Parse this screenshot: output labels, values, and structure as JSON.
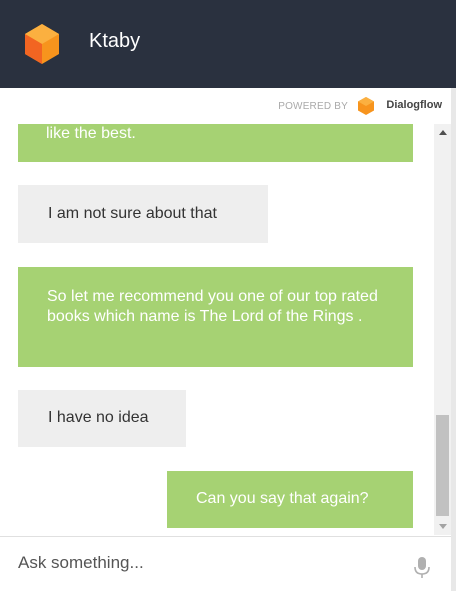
{
  "header": {
    "title": "Ktaby"
  },
  "powered": {
    "label": "POWERED BY",
    "brand": "Dialogflow"
  },
  "messages": [
    {
      "role": "bot",
      "text": "like the best."
    },
    {
      "role": "user",
      "text": "I am not sure about that"
    },
    {
      "role": "bot",
      "text": "So let me recommend you one of our top rated books which name is The Lord of the Rings ."
    },
    {
      "role": "user",
      "text": "I have no idea"
    },
    {
      "role": "bot",
      "text": "Can you say that again?"
    }
  ],
  "input": {
    "placeholder": "Ask something..."
  },
  "icons": {
    "logo": "cube-logo-icon",
    "dialogflow": "dialogflow-logo-icon",
    "mic": "microphone-icon"
  },
  "colors": {
    "header_bg": "#2a313f",
    "bot_bubble": "#a6d273",
    "user_bubble": "#eeeeee",
    "logo_orange": "#f7941d"
  }
}
